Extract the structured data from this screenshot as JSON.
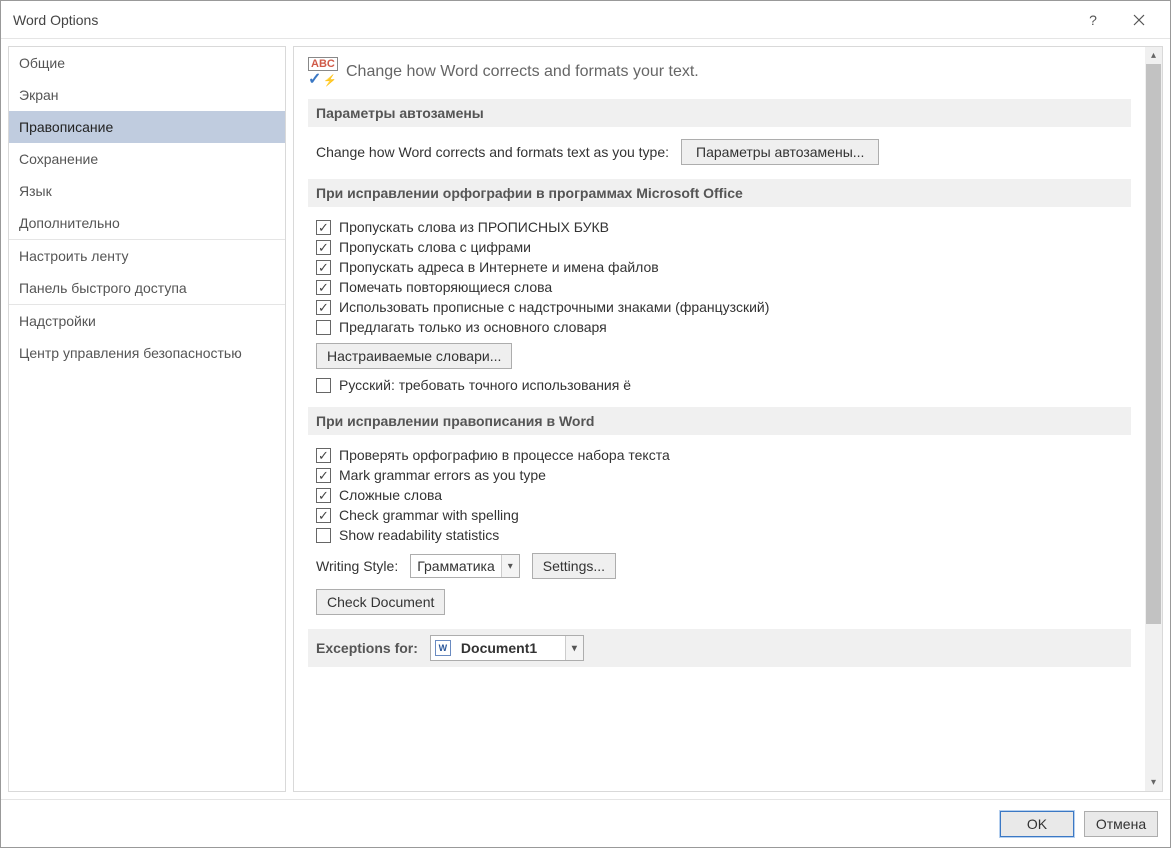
{
  "title": "Word Options",
  "sidebar": {
    "items": [
      "Общие",
      "Экран",
      "Правописание",
      "Сохранение",
      "Язык",
      "Дополнительно",
      "Настроить ленту",
      "Панель быстрого доступа",
      "Надстройки",
      "Центр управления безопасностью"
    ],
    "selected_index": 2
  },
  "header_text": "Change how Word corrects and formats your text.",
  "section1": {
    "head": "Параметры автозамены",
    "desc": "Change how Word corrects and formats text as you type:",
    "button": "Параметры автозамены..."
  },
  "section2": {
    "head": "При исправлении орфографии в программах Microsoft Office",
    "cb1": "Пропускать слова из ПРОПИСНЫХ БУКВ",
    "cb2": "Пропускать слова с цифрами",
    "cb3": "Пропускать адреса в Интернете и имена файлов",
    "cb4": "Помечать повторяющиеся слова",
    "cb5": "Использовать прописные с надстрочными знаками (французский)",
    "cb6": "Предлагать только из основного словаря",
    "dict_button": "Настраиваемые словари...",
    "cb7": "Русский: требовать точного использования ё"
  },
  "section3": {
    "head": "При исправлении правописания в Word",
    "cb1": "Проверять орфографию в процессе набора текста",
    "cb2": "Mark grammar errors as you type",
    "cb3": "Сложные слова",
    "cb4": "Check grammar with spelling",
    "cb5": "Show readability statistics",
    "writing_style_label": "Writing Style:",
    "writing_style_value": "Грамматика",
    "settings_button": "Settings...",
    "check_doc_button": "Check Document"
  },
  "section4": {
    "head": "Exceptions for:",
    "doc_value": "Document1"
  },
  "footer": {
    "ok": "OK",
    "cancel": "Отмена"
  }
}
